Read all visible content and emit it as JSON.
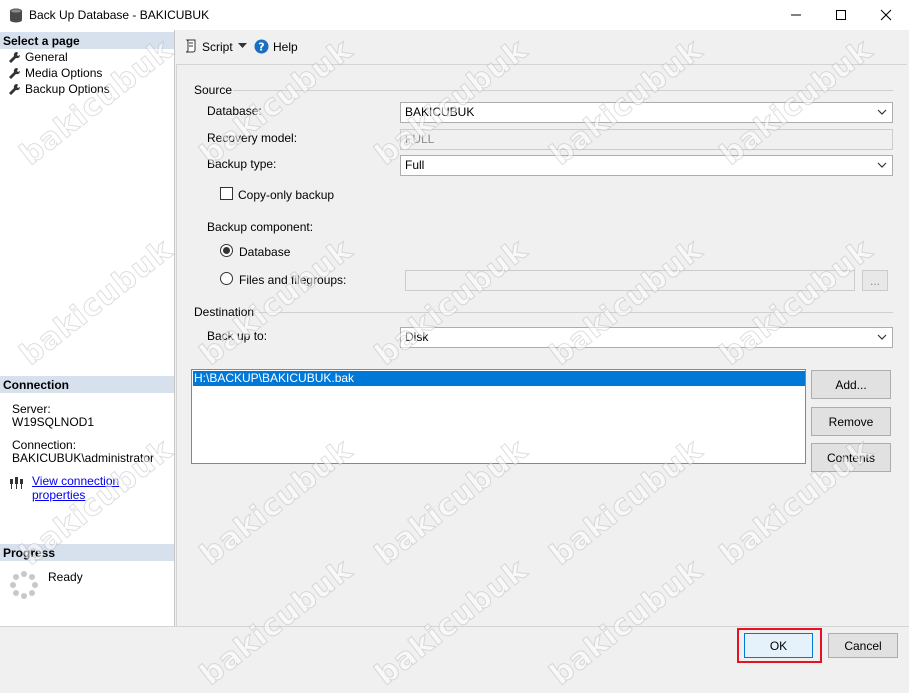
{
  "window": {
    "title": "Back Up Database - BAKICUBUK",
    "minimize_icon": "minimize-icon",
    "maximize_icon": "maximize-icon",
    "close_icon": "close-icon"
  },
  "left": {
    "select_page_header": "Select a page",
    "pages": [
      {
        "label": "General",
        "icon": "wrench-icon"
      },
      {
        "label": "Media Options",
        "icon": "wrench-icon"
      },
      {
        "label": "Backup Options",
        "icon": "wrench-icon"
      }
    ],
    "connection_header": "Connection",
    "server_label": "Server:",
    "server_value": "W19SQLNOD1",
    "connection_label": "Connection:",
    "connection_value": "BAKICUBUK\\administrator",
    "view_connection_link": "View connection properties",
    "progress_header": "Progress",
    "progress_status": "Ready"
  },
  "toolbar": {
    "script_label": "Script",
    "help_label": "Help"
  },
  "source": {
    "group_label": "Source",
    "database_label": "Database:",
    "database_value": "BAKICUBUK",
    "recovery_label": "Recovery model:",
    "recovery_value": "FULL",
    "backup_type_label": "Backup type:",
    "backup_type_value": "Full",
    "copy_only_label": "Copy-only backup",
    "copy_only_checked": false,
    "component_label": "Backup component:",
    "component_database_label": "Database",
    "component_files_label": "Files and filegroups:",
    "component_selected": "Database",
    "browse_label": "..."
  },
  "destination": {
    "group_label": "Destination",
    "backup_to_label": "Back up to:",
    "backup_to_value": "Disk",
    "files": [
      "H:\\BACKUP\\BAKICUBUK.bak"
    ],
    "add_label": "Add...",
    "remove_label": "Remove",
    "contents_label": "Contents"
  },
  "footer": {
    "ok_label": "OK",
    "cancel_label": "Cancel"
  },
  "colors": {
    "selection": "#0078d7",
    "section_header": "#d7e1ee",
    "ok_highlight": "#e81123",
    "help_icon": "#1c6fbf"
  },
  "watermark": "bakicubuk"
}
